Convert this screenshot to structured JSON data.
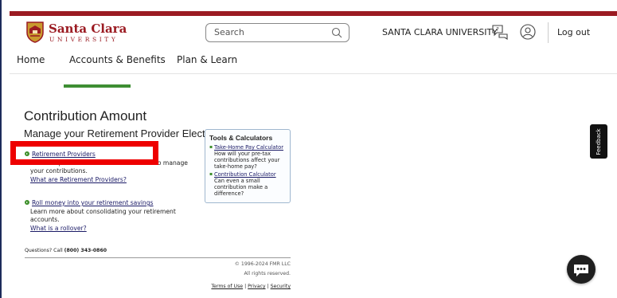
{
  "brand": {
    "name": "Santa Clara",
    "subtitle": "UNIVERSITY",
    "accent": "#9b1b22"
  },
  "header": {
    "search_placeholder": "Search",
    "university_link": "SANTA CLARA UNIVERSITY",
    "logout": "Log out",
    "icons": [
      "search-icon",
      "help-chat-icon",
      "user-icon"
    ]
  },
  "nav": {
    "items": [
      "Home",
      "Accounts & Benefits",
      "Plan & Learn"
    ]
  },
  "main": {
    "title": "Contribution Amount",
    "subtitle": "Manage your Retirement Provider Elections",
    "sections": [
      {
        "link": "Retirement Providers",
        "text_a": "View or update the Retirement Providers to manage",
        "text_b": "your contributions.",
        "sub_link": "What are Retirement Providers?"
      },
      {
        "link": "Roll money into your retirement savings",
        "text_a": "Learn more about consolidating your retirement",
        "text_b": "accounts.",
        "sub_link": "What is a rollover?"
      }
    ]
  },
  "tools": {
    "title": "Tools & Calculators",
    "items": [
      {
        "link": "Take-Home Pay Calculator",
        "desc": "How will your pre-tax contributions affect your take-home pay?"
      },
      {
        "link": "Contribution Calculator",
        "desc": "Can even a small contribution make a difference?"
      }
    ]
  },
  "footer": {
    "questions_label": "Questions? Call",
    "phone": "(800) 343-0860",
    "copyright": "© 1996-2024 FMR LLC",
    "rights": "All rights reserved.",
    "terms": "Terms of Use",
    "privacy": "Privacy",
    "security": "Security",
    "separator": "|"
  },
  "widgets": {
    "feedback": "Feedback",
    "chat_icon": "chat-bubble-icon"
  },
  "colors": {
    "highlight": "#ee0000",
    "active_tab": "#3e8e33",
    "link": "#1a1a66"
  }
}
